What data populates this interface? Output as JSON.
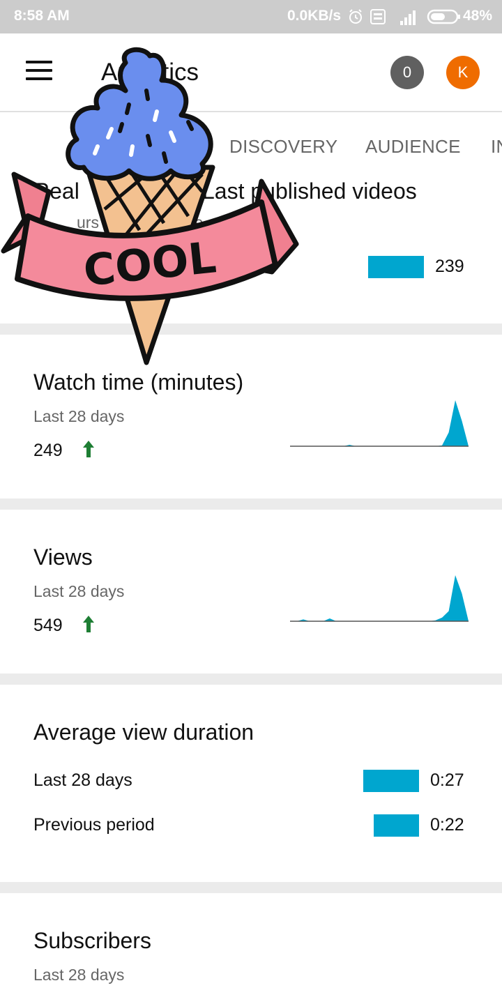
{
  "status_bar": {
    "time": "8:58 AM",
    "network_speed": "0.0KB/s",
    "battery": "48%"
  },
  "app_bar": {
    "title": "Analytics",
    "notification_count": "0",
    "avatar_letter": "K"
  },
  "tabs": [
    "DISCOVERY",
    "AUDIENCE",
    "IN"
  ],
  "realtime_card": {
    "title_left": "Real",
    "title_right": "Last published videos",
    "subtitle_left": "urs",
    "subtitle_right": "vie",
    "bar_value": "239"
  },
  "sticker": {
    "text": "COOL"
  },
  "watch_time_card": {
    "title": "Watch time (minutes)",
    "period": "Last 28 days",
    "value": "249",
    "trend_icon": "arrow-up-icon",
    "sparkline": [
      0,
      0,
      0,
      0,
      0,
      0,
      0,
      0,
      0,
      0.03,
      0,
      0,
      0,
      0,
      0,
      0,
      0,
      0,
      0,
      0,
      0,
      0,
      0,
      0.02,
      0.3,
      1.0,
      0.55,
      0
    ]
  },
  "views_card": {
    "title": "Views",
    "period": "Last 28 days",
    "value": "549",
    "trend_icon": "arrow-up-icon",
    "sparkline": [
      0,
      0,
      0.04,
      0,
      0,
      0,
      0.06,
      0,
      0,
      0,
      0,
      0,
      0,
      0,
      0,
      0,
      0,
      0,
      0,
      0,
      0,
      0,
      0.02,
      0.08,
      0.22,
      1.0,
      0.6,
      0
    ]
  },
  "avg_duration_card": {
    "title": "Average view duration",
    "rows": [
      {
        "label": "Last 28 days",
        "value": "0:27",
        "ratio": 1.0
      },
      {
        "label": "Previous period",
        "value": "0:22",
        "ratio": 0.81
      }
    ]
  },
  "subscribers_card": {
    "title": "Subscribers",
    "period": "Last 28 days"
  },
  "colors": {
    "accent": "#00a6cf",
    "status_bar": "#cccccc",
    "avatar": "#ef6c00",
    "badge": "#606060",
    "trend_up": "#1e7e34",
    "divider": "#ebebeb"
  }
}
